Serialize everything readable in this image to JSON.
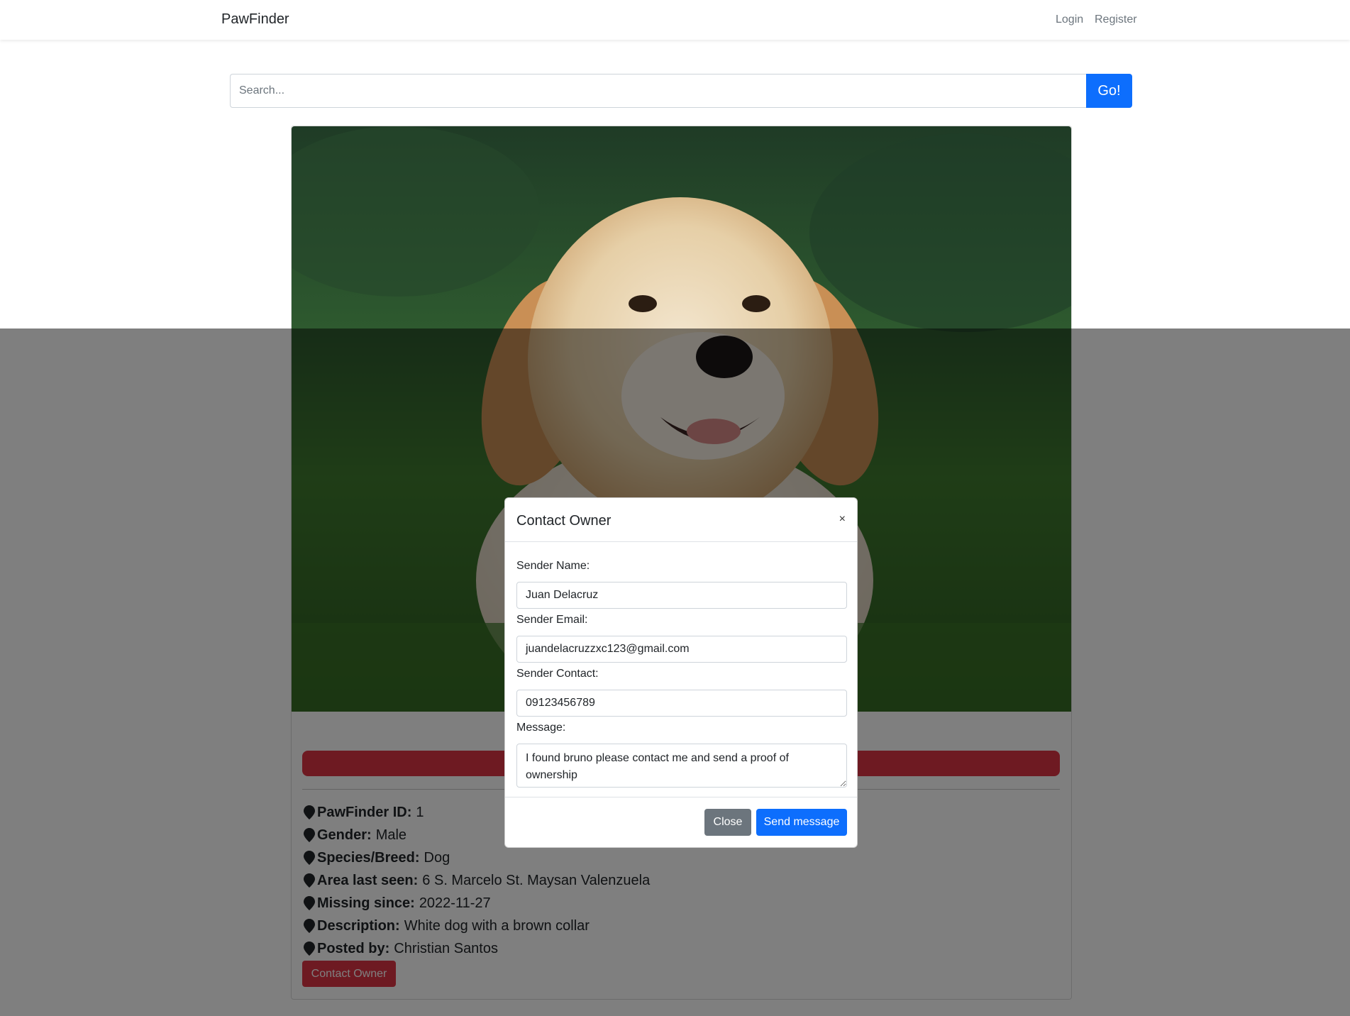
{
  "navbar": {
    "brand": "PawFinder",
    "login": "Login",
    "register": "Register"
  },
  "search": {
    "placeholder": "Search...",
    "button": "Go!"
  },
  "pet": {
    "image_icon": "golden-retriever-puppy-photo",
    "details": [
      {
        "label": "PawFinder ID:",
        "value": "1"
      },
      {
        "label": "Gender:",
        "value": "Male"
      },
      {
        "label": "Species/Breed:",
        "value": "Dog"
      },
      {
        "label": "Area last seen:",
        "value": "6 S. Marcelo St. Maysan Valenzuela"
      },
      {
        "label": "Missing since:",
        "value": "2022-11-27"
      },
      {
        "label": "Description:",
        "value": "White dog with a brown collar"
      },
      {
        "label": "Posted by:",
        "value": "Christian Santos"
      }
    ],
    "contact_button": "Contact Owner",
    "status_color": "#dc3545"
  },
  "modal": {
    "title": "Contact Owner",
    "close_x": "×",
    "fields": {
      "name_label": "Sender Name:",
      "name_value": "Juan Delacruz",
      "email_label": "Sender Email:",
      "email_value": "juandelacruzzxc123@gmail.com",
      "contact_label": "Sender Contact:",
      "contact_value": "09123456789",
      "message_label": "Message:",
      "message_value": "I found bruno please contact me and send a proof of ownership"
    },
    "close_button": "Close",
    "send_button": "Send message"
  },
  "colors": {
    "primary": "#0d6efd",
    "danger": "#dc3545",
    "secondary": "#6c757d"
  }
}
